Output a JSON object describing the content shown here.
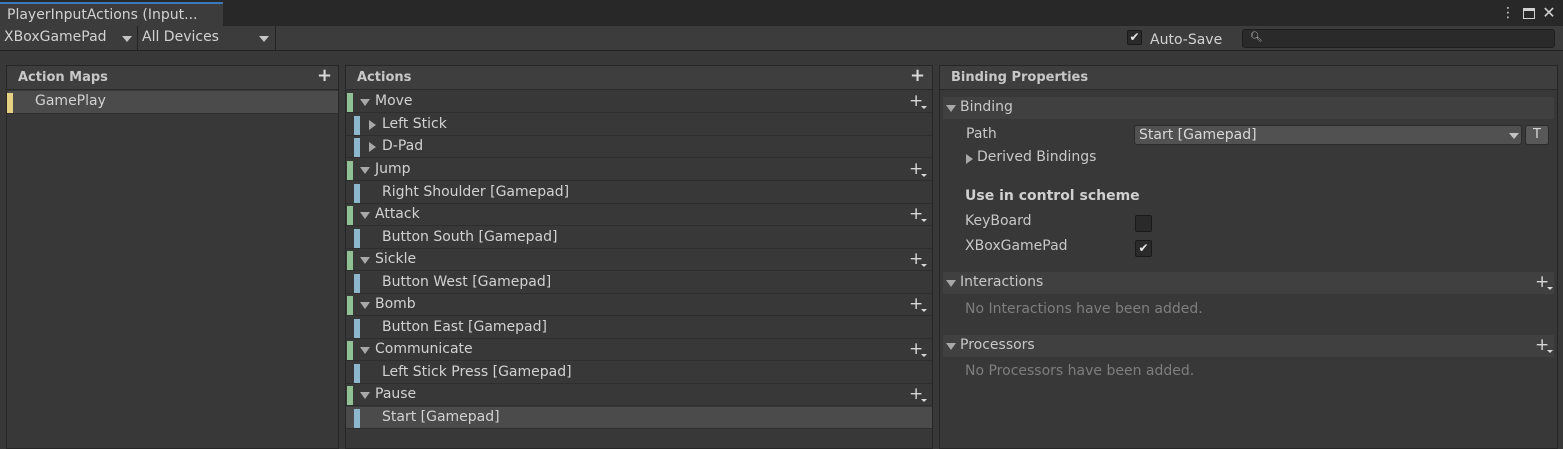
{
  "window": {
    "tab_title": "PlayerInputActions (Input...",
    "menu_icon": "kebab-menu-icon",
    "maximize_icon": "maximize-icon",
    "close_icon": "close-icon"
  },
  "toolbar": {
    "control_scheme": "XBoxGamePad",
    "devices": "All Devices",
    "auto_save_label": "Auto-Save",
    "auto_save_checked": true,
    "search_value": ""
  },
  "action_maps": {
    "title": "Action Maps",
    "items": [
      {
        "label": "GamePlay",
        "selected": true
      }
    ]
  },
  "actions": {
    "title": "Actions",
    "rows": [
      {
        "label": "Move",
        "kind": "action"
      },
      {
        "label": "Left Stick",
        "kind": "composite"
      },
      {
        "label": "D-Pad",
        "kind": "composite"
      },
      {
        "label": "Jump",
        "kind": "action"
      },
      {
        "label": "Right Shoulder [Gamepad]",
        "kind": "binding"
      },
      {
        "label": "Attack",
        "kind": "action"
      },
      {
        "label": "Button South [Gamepad]",
        "kind": "binding"
      },
      {
        "label": "Sickle",
        "kind": "action"
      },
      {
        "label": "Button West [Gamepad]",
        "kind": "binding"
      },
      {
        "label": "Bomb",
        "kind": "action"
      },
      {
        "label": "Button East [Gamepad]",
        "kind": "binding"
      },
      {
        "label": "Communicate",
        "kind": "action"
      },
      {
        "label": "Left Stick Press [Gamepad]",
        "kind": "binding"
      },
      {
        "label": "Pause",
        "kind": "action"
      },
      {
        "label": "Start [Gamepad]",
        "kind": "binding",
        "selected": true
      }
    ]
  },
  "binding_properties": {
    "title": "Binding Properties",
    "binding_section": "Binding",
    "path_label": "Path",
    "path_value": "Start [Gamepad]",
    "t_button": "T",
    "derived_bindings": "Derived Bindings",
    "control_scheme_heading": "Use in control scheme",
    "schemes": [
      {
        "label": "KeyBoard",
        "checked": false
      },
      {
        "label": "XBoxGamePad",
        "checked": true
      }
    ],
    "interactions_section": "Interactions",
    "interactions_empty": "No Interactions have been added.",
    "processors_section": "Processors",
    "processors_empty": "No Processors have been added."
  },
  "colors": {
    "action_map_bar": "#e6d183",
    "action_bar": "#8fc194",
    "binding_bar": "#8cb7cd",
    "tab_accent": "#3a79bb"
  }
}
